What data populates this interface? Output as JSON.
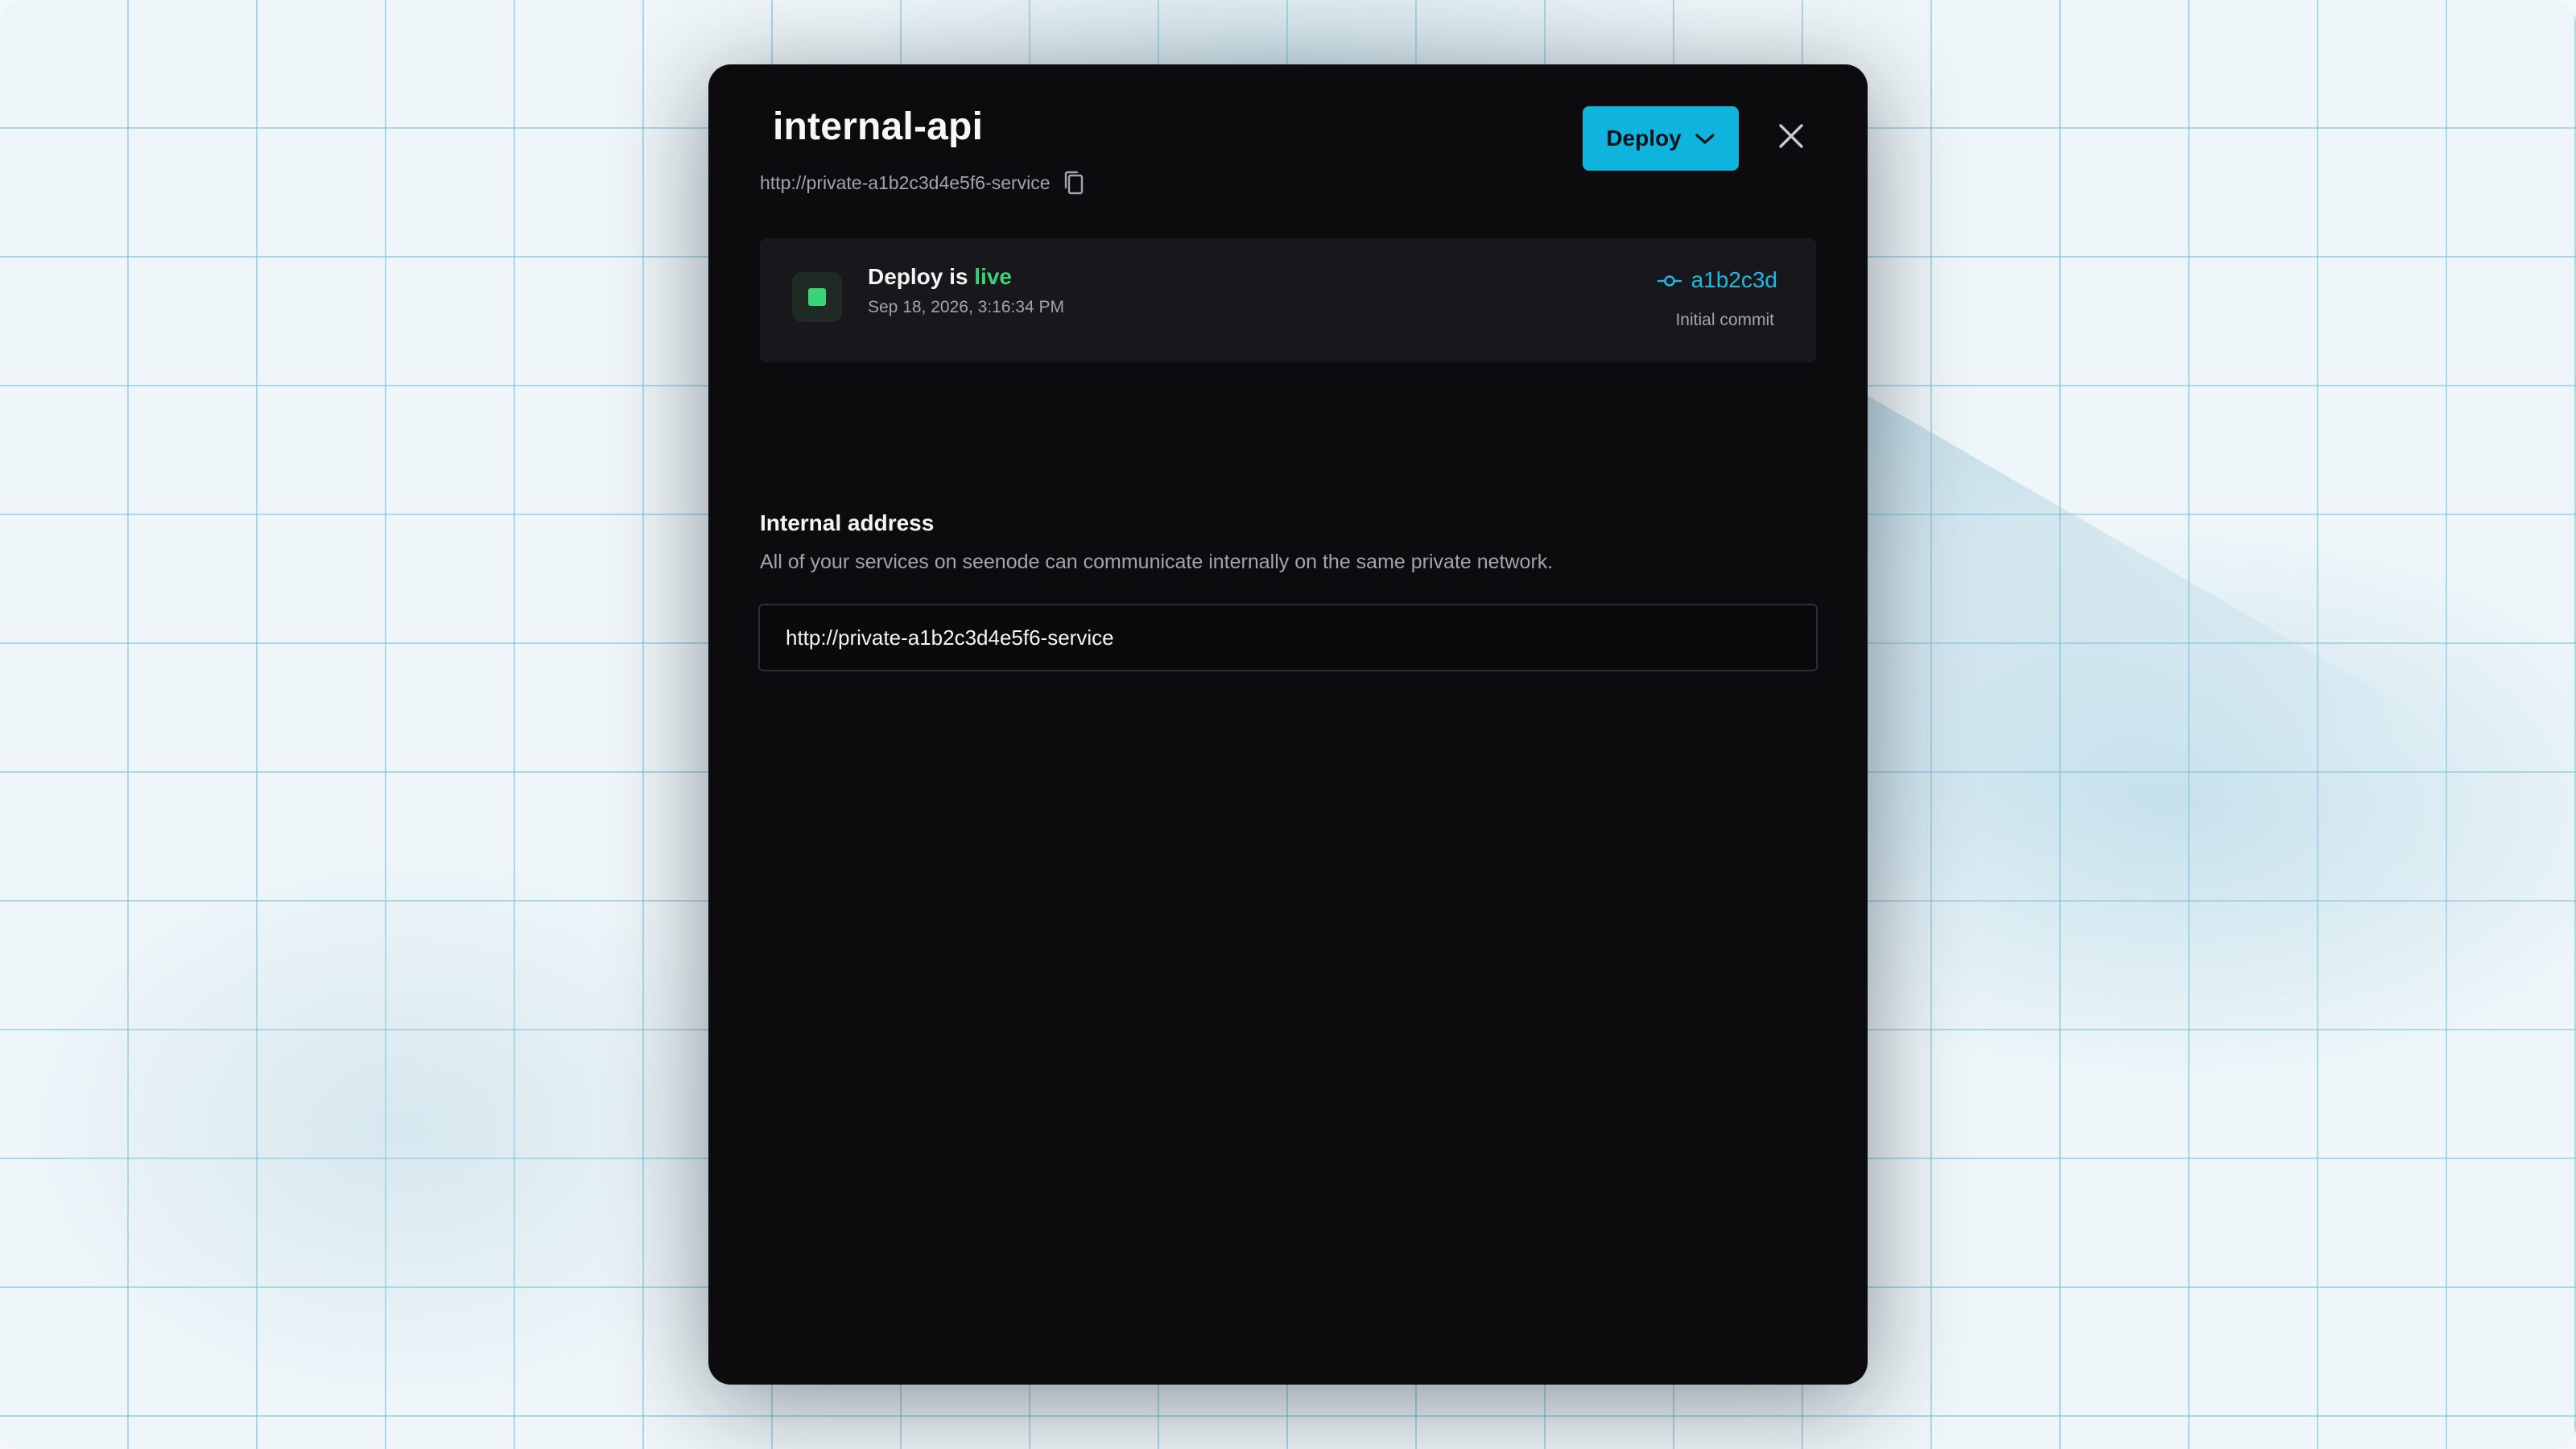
{
  "modal": {
    "title": "internal-api",
    "subtitle_url": "http://private-a1b2c3d4e5f6-service",
    "deploy_button_label": "Deploy"
  },
  "status": {
    "prefix": "Deploy is",
    "state": "live",
    "state_color": "#39d37a",
    "timestamp": "Sep 18, 2026, 3:16:34 PM",
    "commit_hash": "a1b2c3d",
    "commit_message": "Initial commit"
  },
  "internal_address": {
    "heading": "Internal address",
    "description": "All of your services on seenode can communicate internally on the same private network.",
    "value": "http://private-a1b2c3d4e5f6-service"
  },
  "icons": {
    "copy": "copy-icon",
    "close": "close-icon",
    "chevron": "chevron-down-icon",
    "commit": "git-commit-icon"
  },
  "colors": {
    "accent": "#0eb4dc",
    "modal_background": "#0c0c0f",
    "card_background": "#18181c",
    "live": "#39d37a"
  }
}
